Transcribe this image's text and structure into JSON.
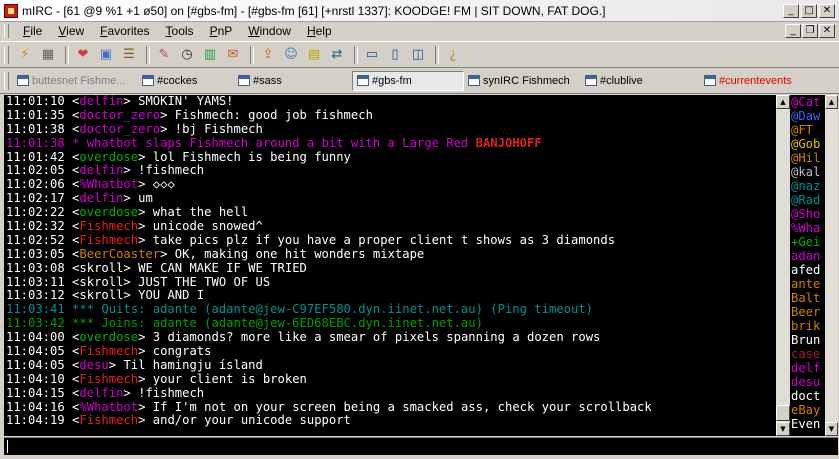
{
  "window": {
    "title": "mIRC - [61 @9 %1 +1 ø50] on [#gbs-fm] - [#gbs-fm [61] [+nrstl 1337]: KOODGE! FM | SIT DOWN, FAT DOG.]",
    "min_glyph": "_",
    "max_glyph": "□",
    "close_glyph": "✕",
    "mdi_restore_glyph": "❐"
  },
  "menu": {
    "items": [
      "File",
      "View",
      "Favorites",
      "Tools",
      "PnP",
      "Window",
      "Help"
    ]
  },
  "toolbar": {
    "buttons": [
      {
        "icon": "connect-icon",
        "glyph": "⚡",
        "color": "#d08020"
      },
      {
        "icon": "options-icon",
        "glyph": "▦",
        "color": "#606060"
      },
      {
        "icon": "favorites-icon",
        "glyph": "❤",
        "color": "#d04040"
      },
      {
        "icon": "address-book-icon",
        "glyph": "▣",
        "color": "#4070c0"
      },
      {
        "icon": "channels-list-icon",
        "glyph": "☰",
        "color": "#806020"
      },
      {
        "icon": "scripts-icon",
        "glyph": "✎",
        "color": "#c04080"
      },
      {
        "icon": "timer-icon",
        "glyph": "◷",
        "color": "#303030"
      },
      {
        "icon": "colors-icon",
        "glyph": "▥",
        "color": "#20a040"
      },
      {
        "icon": "notify-icon",
        "glyph": "✉",
        "color": "#c06020"
      },
      {
        "icon": "dcc-send-icon",
        "glyph": "⇪",
        "color": "#d06000"
      },
      {
        "icon": "dcc-chat-icon",
        "glyph": "☺",
        "color": "#4080c0"
      },
      {
        "icon": "received-files-icon",
        "glyph": "▤",
        "color": "#c0a000"
      },
      {
        "icon": "logs-icon",
        "glyph": "⇄",
        "color": "#206080"
      },
      {
        "icon": "tile-horizontal-icon",
        "glyph": "▭",
        "color": "#2050a0"
      },
      {
        "icon": "tile-vertical-icon",
        "glyph": "▯",
        "color": "#2050a0"
      },
      {
        "icon": "cascade-icon",
        "glyph": "◫",
        "color": "#2050a0"
      },
      {
        "icon": "help-icon",
        "glyph": "¿",
        "color": "#d08020"
      }
    ]
  },
  "switchbar": {
    "tabs": [
      {
        "label": "buttesnet Fishme...",
        "color": "#808080",
        "active": false,
        "icon": "server-icon"
      },
      {
        "label": "#cockes",
        "color": "#000000",
        "active": false,
        "icon": "channel-icon"
      },
      {
        "label": "#sass",
        "color": "#000000",
        "active": false,
        "icon": "channel-icon"
      },
      {
        "label": "#gbs-fm",
        "color": "#000000",
        "active": true,
        "icon": "channel-icon"
      },
      {
        "label": "synIRC Fishmech",
        "color": "#000000",
        "active": false,
        "icon": "server-icon"
      },
      {
        "label": "#clublive",
        "color": "#000000",
        "active": false,
        "icon": "channel-icon"
      },
      {
        "label": "#currentevents",
        "color": "#e00000",
        "active": false,
        "icon": "channel-icon"
      }
    ]
  },
  "colors": {
    "background": "#000000",
    "text": "#ffffff",
    "action": "#d000d0",
    "event": "#009090",
    "nick_red": "#e02020",
    "nick_green": "#00b000",
    "nick_magenta": "#d000d0",
    "nick_white": "#ffffff",
    "nick_orange": "#d08000"
  },
  "messages": [
    {
      "time": "11:01:10",
      "nick": "delfin",
      "nick_color": "#d000d0",
      "text": "SMOKIN' YAMS!",
      "type": "msg"
    },
    {
      "time": "11:01:35",
      "nick": "doctor_zero",
      "nick_color": "#d000d0",
      "text": "Fishmech: good job fishmech",
      "type": "msg"
    },
    {
      "time": "11:01:38",
      "nick": "doctor_zero",
      "nick_color": "#d000d0",
      "text": "!bj Fishmech",
      "type": "msg"
    },
    {
      "time": "11:01:38",
      "nick": "",
      "nick_color": "#d000d0",
      "text": "* whatbot slaps Fishmech around a bit with a Large Red ",
      "highlight": "BANJOHOFF",
      "highlight_color": "#e02020",
      "type": "action"
    },
    {
      "time": "11:01:42",
      "nick": "overdose",
      "nick_color": "#00b000",
      "text": "lol Fishmech is being funny",
      "type": "msg"
    },
    {
      "time": "11:02:05",
      "nick": "delfin",
      "nick_color": "#d000d0",
      "text": "!fishmech",
      "type": "msg"
    },
    {
      "time": "11:02:06",
      "nick": "%Whatbot",
      "nick_color": "#d000d0",
      "text": "◇◇◇",
      "type": "msg"
    },
    {
      "time": "11:02:17",
      "nick": "delfin",
      "nick_color": "#d000d0",
      "text": "um",
      "type": "msg"
    },
    {
      "time": "11:02:22",
      "nick": "overdose",
      "nick_color": "#00b000",
      "text": "what the hell",
      "type": "msg"
    },
    {
      "time": "11:02:32",
      "nick": "Fishmech",
      "nick_color": "#e02020",
      "text": "unicode snowed^",
      "type": "msg"
    },
    {
      "time": "11:02:52",
      "nick": "Fishmech",
      "nick_color": "#e02020",
      "text": "take pics plz if you have a proper client t shows as 3 diamonds",
      "type": "msg"
    },
    {
      "time": "11:03:05",
      "nick": "BeerCoaster",
      "nick_color": "#d08000",
      "text": "OK, making one hit wonders mixtape",
      "type": "msg"
    },
    {
      "time": "11:03:08",
      "nick": "skroll",
      "nick_color": "#ffffff",
      "text": "WE CAN MAKE IF WE TRIED",
      "type": "msg"
    },
    {
      "time": "11:03:11",
      "nick": "skroll",
      "nick_color": "#ffffff",
      "text": "JUST THE TWO OF US",
      "type": "msg"
    },
    {
      "time": "11:03:12",
      "nick": "skroll",
      "nick_color": "#ffffff",
      "text": "YOU AND I",
      "type": "msg"
    },
    {
      "time": "11:03:41",
      "nick": "",
      "nick_color": "#009090",
      "text": "*** Quits: adante (adante@jew-C97EF580.dyn.iinet.net.au) (Ping timeout)",
      "type": "event"
    },
    {
      "time": "11:03:42",
      "nick": "",
      "nick_color": "#00a000",
      "text": "*** Joins: adante (adante@jew-6ED68EBC.dyn.iinet.net.au)",
      "type": "join"
    },
    {
      "time": "11:04:00",
      "nick": "overdose",
      "nick_color": "#00b000",
      "text": "3 diamonds? more like a smear of pixels spanning a dozen rows",
      "type": "msg"
    },
    {
      "time": "11:04:05",
      "nick": "Fishmech",
      "nick_color": "#e02020",
      "text": "congrats",
      "type": "msg"
    },
    {
      "time": "11:04:05",
      "nick": "desu",
      "nick_color": "#d000d0",
      "text": "Til hamingju ísland",
      "type": "msg"
    },
    {
      "time": "11:04:10",
      "nick": "Fishmech",
      "nick_color": "#e02020",
      "text": "your client is broken",
      "type": "msg"
    },
    {
      "time": "11:04:15",
      "nick": "delfin",
      "nick_color": "#d000d0",
      "text": "!fishmech",
      "type": "msg"
    },
    {
      "time": "11:04:16",
      "nick": "%Whatbot",
      "nick_color": "#d000d0",
      "text": "If I'm not on your screen being a smacked ass, check your scrollback",
      "type": "msg"
    },
    {
      "time": "11:04:19",
      "nick": "Fishmech",
      "nick_color": "#e02020",
      "text": "and/or your unicode support",
      "type": "msg"
    }
  ],
  "nicklist": [
    {
      "nick": "@Cat",
      "color": "#d000d0"
    },
    {
      "nick": "@Daw",
      "color": "#4060ff"
    },
    {
      "nick": "@FT",
      "color": "#d08000"
    },
    {
      "nick": "@Gob",
      "color": "#e0c000"
    },
    {
      "nick": "@Hil",
      "color": "#d08000"
    },
    {
      "nick": "@kal",
      "color": "#c0c0c0"
    },
    {
      "nick": "@naz",
      "color": "#009090"
    },
    {
      "nick": "@Rad",
      "color": "#009090"
    },
    {
      "nick": "@Sho",
      "color": "#d000d0"
    },
    {
      "nick": "%Wha",
      "color": "#d000d0"
    },
    {
      "nick": "+Gei",
      "color": "#00b000"
    },
    {
      "nick": "adan",
      "color": "#d000d0"
    },
    {
      "nick": "afed",
      "color": "#ffffff"
    },
    {
      "nick": "ante",
      "color": "#d08000"
    },
    {
      "nick": "Balt",
      "color": "#d08000"
    },
    {
      "nick": "Beer",
      "color": "#d08000"
    },
    {
      "nick": "brik",
      "color": "#d08000"
    },
    {
      "nick": "Brun",
      "color": "#ffffff"
    },
    {
      "nick": "case",
      "color": "#a02020"
    },
    {
      "nick": "delf",
      "color": "#d000d0"
    },
    {
      "nick": "desu",
      "color": "#d000d0"
    },
    {
      "nick": "doct",
      "color": "#ffffff"
    },
    {
      "nick": "eBay",
      "color": "#d08000"
    },
    {
      "nick": "Even",
      "color": "#ffffff"
    }
  ],
  "input": {
    "value": ""
  }
}
